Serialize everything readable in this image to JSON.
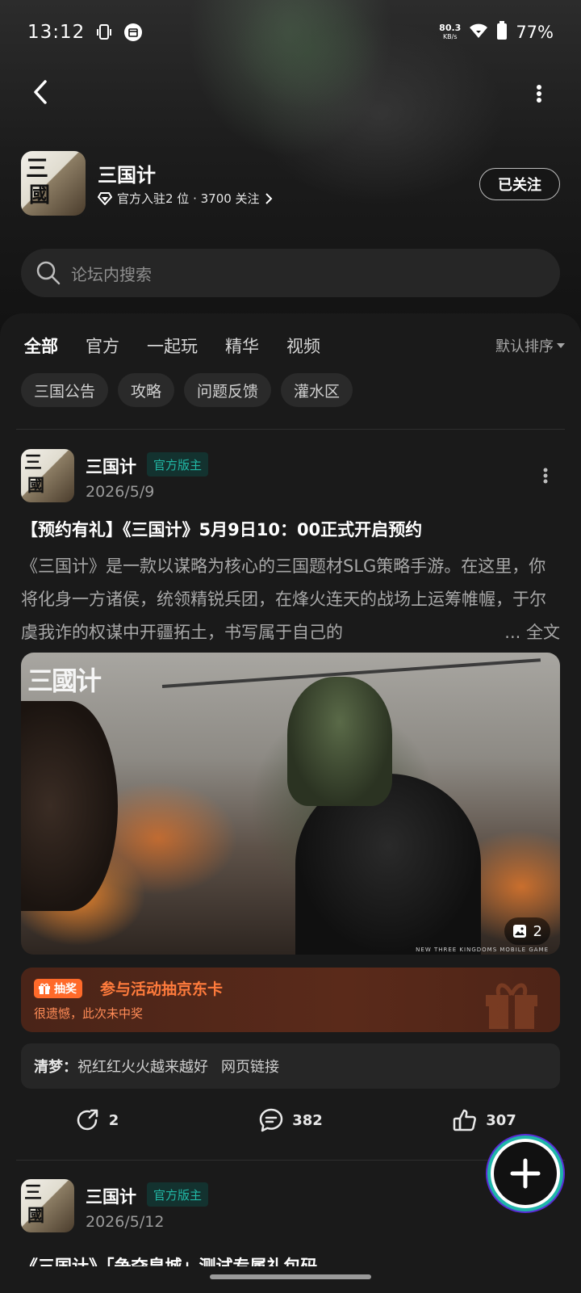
{
  "status_bar": {
    "time": "13:12",
    "net_speed": "80.3",
    "net_unit": "KB/s",
    "battery": "77%"
  },
  "forum": {
    "name": "三国计",
    "meta": "官方入驻2 位 · 3700 关注",
    "follow_label": "已关注"
  },
  "search": {
    "placeholder": "论坛内搜索"
  },
  "tabs": [
    {
      "label": "全部",
      "active": true
    },
    {
      "label": "官方"
    },
    {
      "label": "一起玩"
    },
    {
      "label": "精华"
    },
    {
      "label": "视频"
    }
  ],
  "sort_label": "默认排序",
  "chips": [
    "三国公告",
    "攻略",
    "问题反馈",
    "灌水区"
  ],
  "posts": [
    {
      "author": "三国计",
      "badge": "官方版主",
      "date": "2026/5/9",
      "title": "【预约有礼】《三国计》5月9日10：00正式开启预约",
      "body": "《三国计》是一款以谋略为核心的三国题材SLG策略手游。在这里，你将化身一方诸侯，统领精锐兵团，在烽火连天的战场上运筹帷幄，于尔虞我诈的权谋中开疆拓土，书写属于自己的",
      "read_more": "... 全文",
      "image": {
        "logo_text": "三國计",
        "caption": "NEW THREE KINGDOMS MOBILE GAME",
        "count": "2"
      },
      "lottery": {
        "tag": "抽奖",
        "title": "参与活动抽京东卡",
        "result": "很遗憾，此次未中奖"
      },
      "comment": {
        "user": "清梦：",
        "text": "祝红红火火越来越好",
        "link": "网页链接"
      },
      "stats": {
        "shares": "2",
        "comments": "382",
        "likes": "307"
      }
    },
    {
      "author": "三国计",
      "badge": "官方版主",
      "date": "2026/5/12",
      "title": "《三国计》「争夺皇城」测试专属礼包码"
    }
  ],
  "logo_glyphs": [
    "三",
    "國"
  ],
  "colors": {
    "accent": "#1fb5a8",
    "lottery_orange": "#ff7b3c",
    "bg": "#1a1a1a"
  }
}
